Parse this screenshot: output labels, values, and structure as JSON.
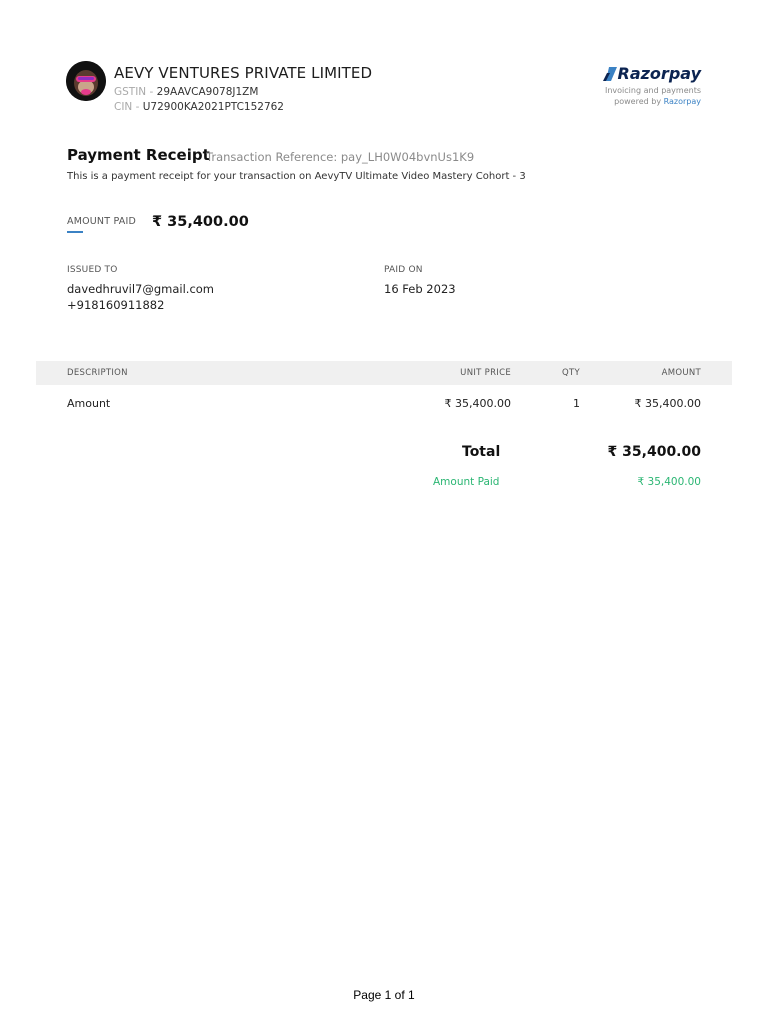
{
  "header": {
    "company_name": "AEVY VENTURES PRIVATE LIMITED",
    "gstin_label": "GSTIN - ",
    "gstin_value": "29AAVCA9078J1ZM",
    "cin_label": "CIN - ",
    "cin_value": "U72900KA2021PTC152762",
    "brand_name": "Razorpay",
    "brand_line1": "Invoicing and payments",
    "brand_line2_prefix": "powered by ",
    "brand_line2_link": "Razorpay"
  },
  "receipt": {
    "title": "Payment Receipt",
    "transaction_reference": "Transaction Reference: pay_LH0W04bvnUs1K9",
    "description": "This is a payment receipt for your transaction on AevyTV Ultimate Video Mastery Cohort - 3",
    "amount_paid_label": "AMOUNT PAID",
    "amount_paid_value": "₹ 35,400.00",
    "issued_to_label": "ISSUED TO",
    "issued_to_email": "davedhruvil7@gmail.com",
    "issued_to_phone": "+918160911882",
    "paid_on_label": "PAID ON",
    "paid_on_date": "16 Feb 2023"
  },
  "table": {
    "headers": {
      "description": "DESCRIPTION",
      "unit_price": "UNIT PRICE",
      "qty": "QTY",
      "amount": "AMOUNT"
    },
    "rows": [
      {
        "description": "Amount",
        "unit_price": "₹ 35,400.00",
        "qty": "1",
        "amount": "₹ 35,400.00"
      }
    ],
    "total_label": "Total",
    "total_value": "₹ 35,400.00",
    "amount_paid_label": "Amount Paid",
    "amount_paid_value": "₹ 35,400.00"
  },
  "footer": {
    "page": "Page 1 of 1"
  },
  "colors": {
    "accent_blue": "#3b82c4",
    "paid_green": "#2bb673",
    "razorpay_navy": "#0c2451"
  }
}
